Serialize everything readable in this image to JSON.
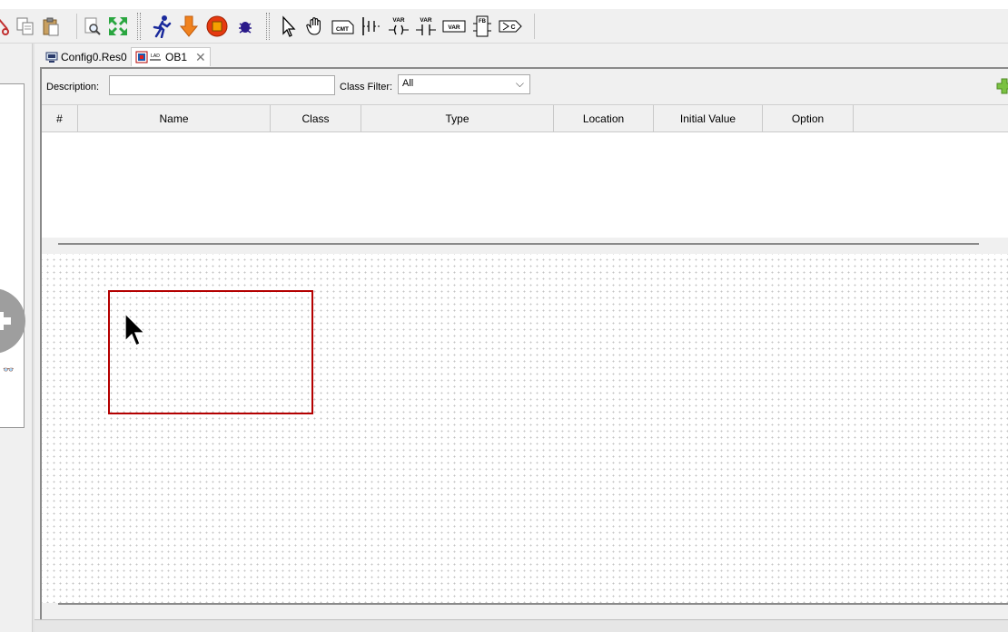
{
  "toolbar": {
    "buttons": [
      {
        "name": "cut",
        "icon": "scissors-icon"
      },
      {
        "name": "copy",
        "icon": "copy-icon"
      },
      {
        "name": "paste",
        "icon": "paste-icon"
      },
      {
        "name": "zoom",
        "icon": "magnifier-icon"
      },
      {
        "name": "fit",
        "icon": "expand-icon"
      },
      {
        "name": "run",
        "icon": "running-man-icon"
      },
      {
        "name": "download",
        "icon": "arrow-down-icon"
      },
      {
        "name": "chip",
        "icon": "chip-icon"
      },
      {
        "name": "debug",
        "icon": "bug-icon"
      },
      {
        "name": "select",
        "icon": "pointer-icon"
      },
      {
        "name": "pan",
        "icon": "hand-icon"
      }
    ],
    "labels": {
      "comment": "CMT",
      "var_in": "VAR",
      "var_out": "VAR",
      "var": "VAR",
      "fb": "FB",
      "coil": "C"
    }
  },
  "tabs": [
    {
      "label": "Config0.Res0",
      "icon": "config-icon",
      "active": false
    },
    {
      "label": "OB1",
      "icon": "ladder-program-icon",
      "active": true
    }
  ],
  "editor": {
    "description_label": "Description:",
    "description_value": "",
    "class_filter_label": "Class Filter:",
    "class_filter_value": "All",
    "columns": [
      "#",
      "Name",
      "Class",
      "Type",
      "Location",
      "Initial Value",
      "Option"
    ],
    "rows": []
  },
  "colors": {
    "selection": "#b40000",
    "accent_green": "#7ac142",
    "run_blue": "#1a2a9c",
    "download_orange": "#f0821e"
  }
}
